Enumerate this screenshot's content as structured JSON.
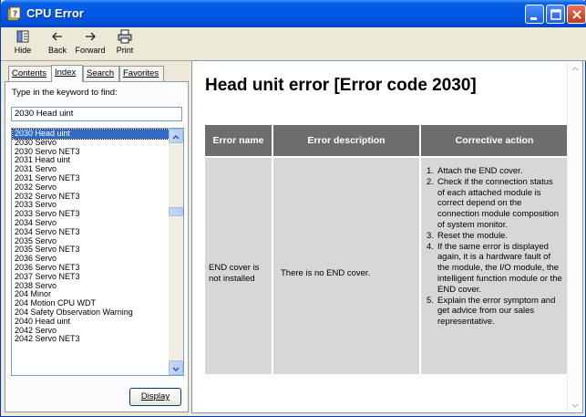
{
  "window": {
    "title": "CPU Error"
  },
  "toolbar": {
    "hide": "Hide",
    "back": "Back",
    "forward": "Forward",
    "print": "Print"
  },
  "tabs": {
    "contents": "Contents",
    "index": "Index",
    "search": "Search",
    "favorites": "Favorites"
  },
  "index_panel": {
    "find_label": "Type in the keyword to find:",
    "keyword_value": "2030 Head uint",
    "items": [
      "2030 Head uint",
      "2030 Servo",
      "2030 Servo NET3",
      "2031 Head uint",
      "2031 Servo",
      "2031 Servo NET3",
      "2032 Servo",
      "2032 Servo NET3",
      "2033 Servo",
      "2033 Servo NET3",
      "2034 Servo",
      "2034 Servo NET3",
      "2035 Servo",
      "2035 Servo NET3",
      "2036 Servo",
      "2036 Servo NET3",
      "2037 Servo NET3",
      "2038 Servo",
      "204 Minor",
      "204 Motion CPU WDT",
      "204 Safety Observation Warning",
      "2040 Head uint",
      "2042 Servo",
      "2042 Servo NET3"
    ],
    "selected_index": 0,
    "display_button": "Display"
  },
  "content": {
    "title": "Head unit error [Error code 2030]",
    "table": {
      "headers": [
        "Error name",
        "Error description",
        "Corrective action"
      ],
      "error_name": "END cover is not installed",
      "error_description": "There is no END cover.",
      "corrective_action": [
        {
          "num": "1.",
          "text": "Attach the END cover."
        },
        {
          "num": "2.",
          "text": "Check if the connection status of each attached module is correct depend on the connection module composition of system monitor."
        },
        {
          "num": "3.",
          "text": "Reset the module."
        },
        {
          "num": "4.",
          "text": "If the same error is displayed again, it is a hardware fault of the module, the I/O module, the intelligent function module or the END cover."
        },
        {
          "num": "5.",
          "text": "Explain the error symptom and get advice from our sales representative."
        }
      ]
    }
  },
  "colors": {
    "titlebar": "#0058e6",
    "header_cell": "#6d6d6d",
    "body_cell": "#d7d7d7",
    "selection": "#316ac5"
  }
}
